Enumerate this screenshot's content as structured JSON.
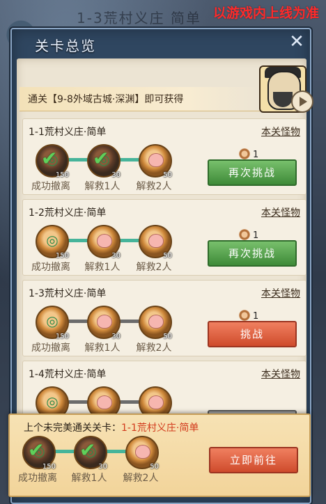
{
  "watermark": "以游戏内上线为准",
  "bg_faint": "1-3荒村义庄 简单",
  "header": {
    "title": "关卡总览",
    "close_icon": "crossed-swords-close-icon"
  },
  "banner": {
    "text": "通关【9-8外域古城·深渊】即可获得"
  },
  "stages": [
    {
      "title": "1-1荒村义庄·简单",
      "monster_link": "本关怪物",
      "reward_count": "1",
      "button": "再次挑战",
      "button_style": "green",
      "tracks_done": [
        true,
        true
      ],
      "medals": [
        {
          "label": "成功撤离",
          "count": "150",
          "icon": "escape-medal-icon",
          "completed": true
        },
        {
          "label": "解救1人",
          "count": "30",
          "icon": "rescue-medal-icon",
          "completed": true
        },
        {
          "label": "解救2人",
          "count": "50",
          "icon": "peach-medal-icon",
          "completed": false
        }
      ]
    },
    {
      "title": "1-2荒村义庄·简单",
      "monster_link": "本关怪物",
      "reward_count": "1",
      "button": "再次挑战",
      "button_style": "green",
      "tracks_done": [
        true,
        true
      ],
      "medals": [
        {
          "label": "成功撤离",
          "count": "150",
          "icon": "escape-medal-icon",
          "completed": false
        },
        {
          "label": "解救1人",
          "count": "30",
          "icon": "peach-medal-icon",
          "completed": false
        },
        {
          "label": "解救2人",
          "count": "50",
          "icon": "peach-medal-icon",
          "completed": false
        }
      ]
    },
    {
      "title": "1-3荒村义庄·简单",
      "monster_link": "本关怪物",
      "reward_count": "1",
      "button": "挑战",
      "button_style": "red",
      "tracks_done": [
        false,
        false
      ],
      "medals": [
        {
          "label": "成功撤离",
          "count": "150",
          "icon": "escape-medal-icon",
          "completed": false
        },
        {
          "label": "解救1人",
          "count": "30",
          "icon": "peach-medal-icon",
          "completed": false
        },
        {
          "label": "解救2人",
          "count": "50",
          "icon": "peach-medal-icon",
          "completed": false
        }
      ]
    },
    {
      "title": "1-4荒村义庄·简单",
      "monster_link": "本关怪物",
      "reward_count": "",
      "button": "",
      "button_style": "gray",
      "tracks_done": [
        false,
        false
      ],
      "medals": [
        {
          "label": "",
          "count": "",
          "icon": "escape-medal-icon",
          "completed": false
        },
        {
          "label": "",
          "count": "",
          "icon": "peach-medal-icon",
          "completed": false
        },
        {
          "label": "",
          "count": "",
          "icon": "peach-medal-icon",
          "completed": false
        }
      ]
    }
  ],
  "last_incomplete": {
    "prefix": "上个未完美通关关卡：",
    "stage": "1-1荒村义庄·简单",
    "button": "立即前往",
    "medals": [
      {
        "label": "成功撤离",
        "count": "150",
        "icon": "escape-medal-icon",
        "completed": true
      },
      {
        "label": "解救1人",
        "count": "30",
        "icon": "rescue-medal-icon",
        "completed": true
      },
      {
        "label": "解救2人",
        "count": "50",
        "icon": "peach-medal-icon",
        "completed": false
      }
    ]
  }
}
